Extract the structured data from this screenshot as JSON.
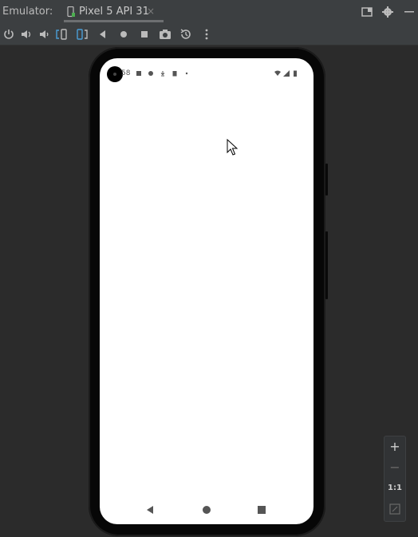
{
  "header": {
    "title": "Emulator:",
    "tab_label": "Pixel 5 API 31",
    "tab_close": "×"
  },
  "toolbar": {
    "buttons": [
      "power-icon",
      "volume-up-icon",
      "volume-down-icon",
      "rotate-left-icon",
      "rotate-right-icon",
      "back-icon",
      "home-icon",
      "overview-icon",
      "camera-icon",
      "snapshot-icon",
      "more-icon"
    ]
  },
  "device": {
    "statusbar": {
      "time": "58",
      "right_icons": [
        "wifi-icon",
        "signal-icon",
        "battery-icon"
      ]
    }
  },
  "zoom": {
    "zoom_in": "+",
    "zoom_out": "−",
    "actual_size": "1:1"
  },
  "colors": {
    "background": "#2b2b2b",
    "toolbar": "#3c3f41",
    "screen": "#ffffff",
    "frame": "#070707"
  }
}
